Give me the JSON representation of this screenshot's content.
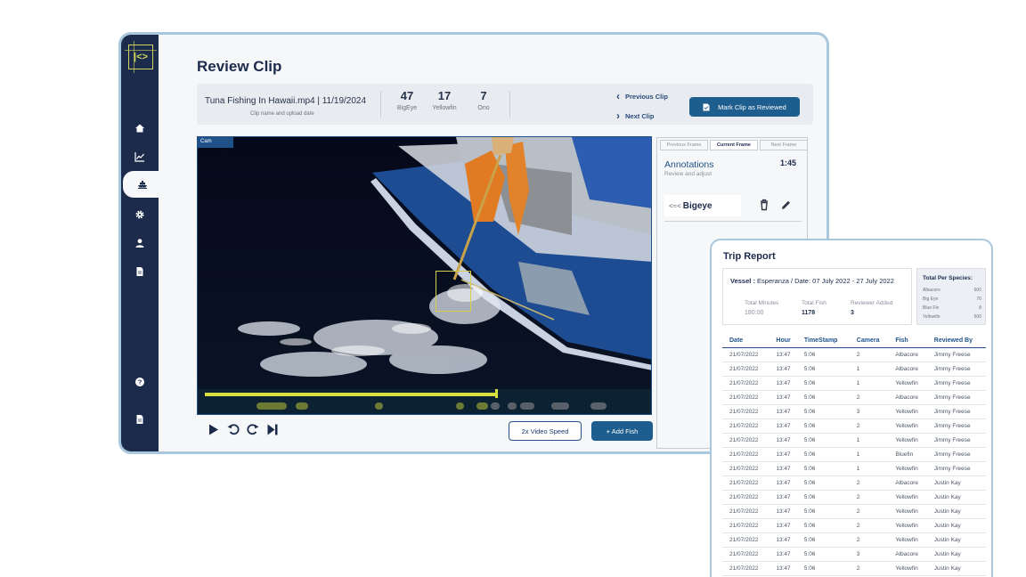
{
  "window": {
    "logo": "|<>",
    "page_title": "Review Clip",
    "clip": {
      "name": "Tuna Fishing In Hawaii.mp4 | 11/19/2024",
      "subtitle": "Clip name and upload date",
      "counts": [
        {
          "value": "47",
          "label": "BigEye"
        },
        {
          "value": "17",
          "label": "Yellowfin"
        },
        {
          "value": "7",
          "label": "Ono"
        }
      ],
      "previous_clip": "Previous Clip",
      "next_clip": "Next Clip",
      "mark_reviewed": "Mark Clip as Reviewed"
    },
    "video": {
      "cam_label": "Cam",
      "progress": 0.66,
      "speed_button": "2x  Video Speed",
      "add_fish_button": "+  Add Fish"
    },
    "annotations": {
      "tabs": [
        "Previous Frame",
        "Current Frame",
        "Next Frame"
      ],
      "active_tab": 1,
      "title": "Annotations",
      "subtitle": "Review and adjust",
      "time": "1:45",
      "item_label": "Bigeye"
    }
  },
  "trip_report": {
    "title": "Trip Report",
    "vessel_label": "Vessel : ",
    "vessel_value": "Esperanza / Date: 07 July 2022 - 27 July 2022",
    "stats": [
      {
        "label": "Total Minutes",
        "value": "180:00"
      },
      {
        "label": "Total Fish",
        "value": "1178"
      },
      {
        "label": "Reviewer Added",
        "value": "3"
      }
    ],
    "species_title": "Total Per Species:",
    "species": [
      {
        "name": "Albacore",
        "count": "600"
      },
      {
        "name": "Big Eye",
        "count": "70"
      },
      {
        "name": "Blue Fin",
        "count": "8"
      },
      {
        "name": "Yellowfin",
        "count": "500"
      }
    ],
    "columns": [
      "Date",
      "Hour",
      "TimeStamp",
      "Camera",
      "Fish",
      "Reviewed By"
    ],
    "rows": [
      [
        "21/07/2022",
        "13:47",
        "5:06",
        "2",
        "Albacore",
        "Jimmy Freese"
      ],
      [
        "21/07/2022",
        "13:47",
        "5:06",
        "1",
        "Albacore",
        "Jimmy Freese"
      ],
      [
        "21/07/2022",
        "13:47",
        "5:06",
        "1",
        "Yellowfin",
        "Jimmy Freese"
      ],
      [
        "21/07/2022",
        "13:47",
        "5:06",
        "2",
        "Albacore",
        "Jimmy Freese"
      ],
      [
        "21/07/2022",
        "13:47",
        "5:06",
        "3",
        "Yellowfin",
        "Jimmy Freese"
      ],
      [
        "21/07/2022",
        "13:47",
        "5:06",
        "2",
        "Yellowfin",
        "Jimmy Freese"
      ],
      [
        "21/07/2022",
        "13:47",
        "5:06",
        "1",
        "Yellowfin",
        "Jimmy Freese"
      ],
      [
        "21/07/2022",
        "13:47",
        "5:06",
        "1",
        "Bluefin",
        "Jimmy Freese"
      ],
      [
        "21/07/2022",
        "13:47",
        "5:06",
        "1",
        "Yellowfin",
        "Jimmy Freese"
      ],
      [
        "21/07/2022",
        "13:47",
        "5:06",
        "2",
        "Albacore",
        "Justin Kay"
      ],
      [
        "21/07/2022",
        "13:47",
        "5:06",
        "2",
        "Yellowfin",
        "Justin Kay"
      ],
      [
        "21/07/2022",
        "13:47",
        "5:06",
        "2",
        "Yellowfin",
        "Justin Kay"
      ],
      [
        "21/07/2022",
        "13:47",
        "5:06",
        "2",
        "Yellowfin",
        "Justin Kay"
      ],
      [
        "21/07/2022",
        "13:47",
        "5:06",
        "2",
        "Yellowfin",
        "Justin Kay"
      ],
      [
        "21/07/2022",
        "13:47",
        "5:06",
        "3",
        "Albacore",
        "Justin Kay"
      ],
      [
        "21/07/2022",
        "13:47",
        "5:06",
        "2",
        "Yellowfin",
        "Justin Kay"
      ]
    ]
  },
  "colors": {
    "navy": "#1c2b4c",
    "accent_blue": "#1e5e8e",
    "highlight": "#d8e03e"
  }
}
